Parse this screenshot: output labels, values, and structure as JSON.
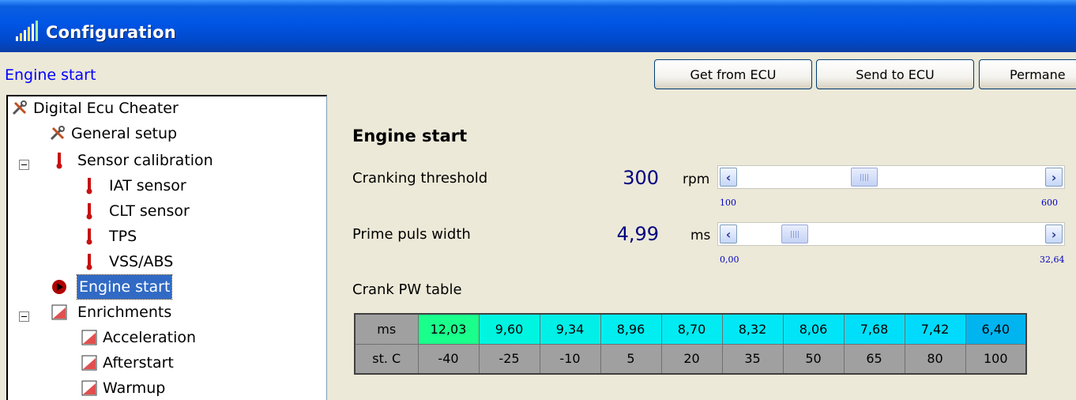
{
  "window": {
    "title": "Configuration"
  },
  "header": {
    "breadcrumb": "Engine start",
    "buttons": {
      "get": "Get from ECU",
      "send": "Send to ECU",
      "permanent": "Permane"
    }
  },
  "tree": {
    "items": [
      {
        "label": "Digital Ecu Cheater",
        "icon": "tools-icon"
      },
      {
        "label": "General setup",
        "icon": "tools-icon"
      },
      {
        "label": "Sensor calibration",
        "icon": "thermometer-icon"
      },
      {
        "label": "IAT sensor",
        "icon": "thermometer-icon"
      },
      {
        "label": "CLT sensor",
        "icon": "thermometer-icon"
      },
      {
        "label": "TPS",
        "icon": "thermometer-icon"
      },
      {
        "label": "VSS/ABS",
        "icon": "thermometer-icon"
      },
      {
        "label": "Engine start",
        "icon": "play-icon"
      },
      {
        "label": "Enrichments",
        "icon": "chart-icon"
      },
      {
        "label": "Acceleration",
        "icon": "chart-icon"
      },
      {
        "label": "Afterstart",
        "icon": "chart-icon"
      },
      {
        "label": "Warmup",
        "icon": "chart-icon"
      }
    ]
  },
  "content": {
    "title": "Engine start",
    "cranking": {
      "label": "Cranking threshold",
      "value": "300",
      "unit": "rpm",
      "min": "100",
      "max": "600",
      "fraction": 0.4
    },
    "prime": {
      "label": "Prime puls width",
      "value": "4,99",
      "unit": "ms",
      "min": "0,00",
      "max": "32,64",
      "fraction": 0.153
    },
    "table_label": "Crank PW table",
    "table": {
      "row1_header": "ms",
      "row1": [
        "12,03",
        "9,60",
        "9,34",
        "8,96",
        "8,70",
        "8,32",
        "8,06",
        "7,68",
        "7,42",
        "6,40"
      ],
      "row2_header": "st. C",
      "row2": [
        "-40",
        "-25",
        "-10",
        "5",
        "20",
        "35",
        "50",
        "65",
        "80",
        "100"
      ],
      "row1_colors": [
        "#1aff8c",
        "#00f5e0",
        "#00f0e8",
        "#00eef0",
        "#00ecf2",
        "#00e8f6",
        "#00e4f8",
        "#00dffa",
        "#00dafc",
        "#00b4f0"
      ]
    }
  },
  "colors": {
    "titlebar": "#0055e5",
    "selection": "#316ac5",
    "value_text": "#000080"
  }
}
